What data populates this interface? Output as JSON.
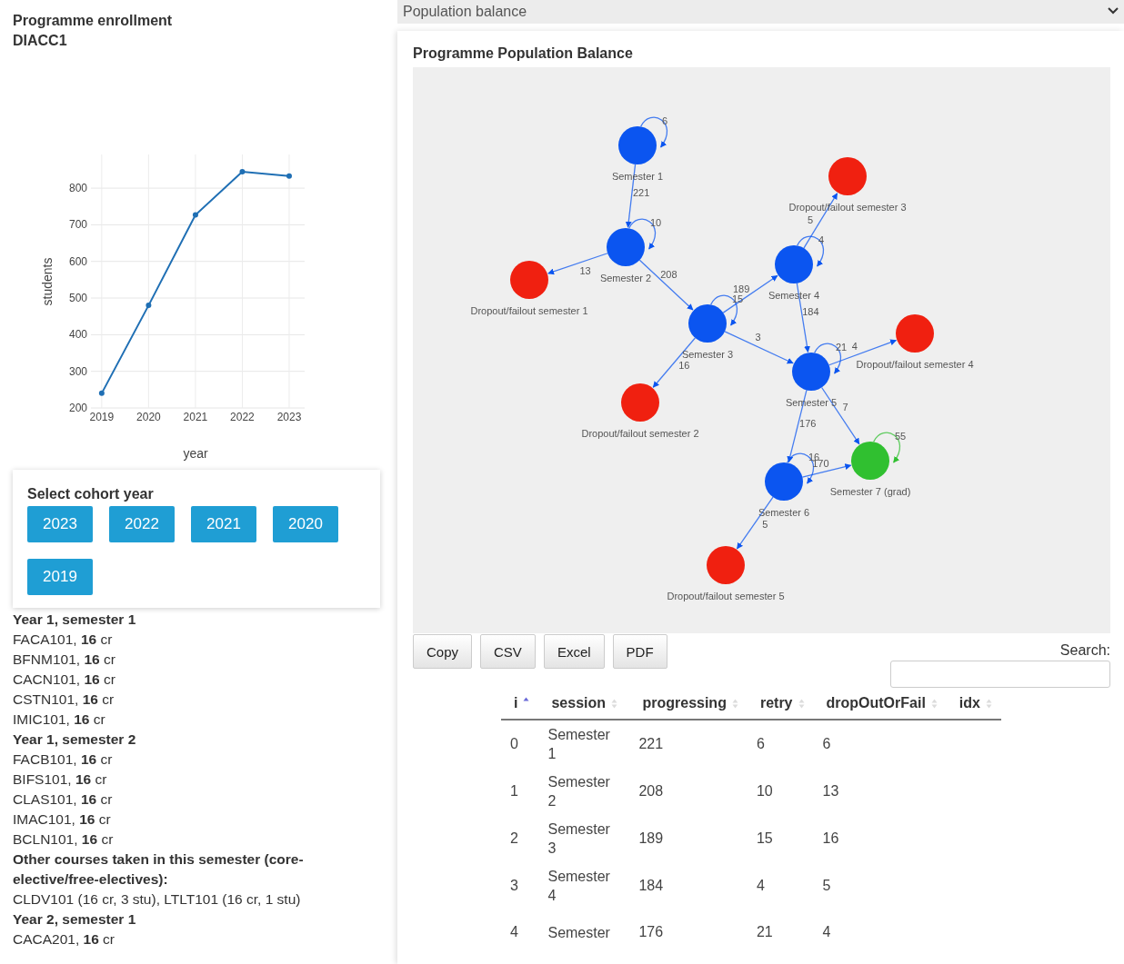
{
  "enrollment": {
    "title": "Programme enrollment",
    "subtitle": "DIACC1",
    "chart_data": {
      "type": "line",
      "xlabel": "year",
      "ylabel": "students",
      "grid": true,
      "x": [
        2019,
        2020,
        2021,
        2022,
        2023
      ],
      "xticks": [
        2019,
        2020,
        2021,
        2022,
        2023
      ],
      "yticks": [
        200,
        300,
        400,
        500,
        600,
        700,
        800
      ],
      "xlim": [
        2018.77,
        2023.33
      ],
      "ylim": [
        200,
        892
      ],
      "series": [
        {
          "color": "#1f6fb4",
          "marker": true,
          "values": [
            240,
            480,
            727,
            845,
            833
          ]
        }
      ]
    }
  },
  "cohort": {
    "title": "Select cohort year",
    "years": [
      "2023",
      "2022",
      "2021",
      "2020",
      "2019"
    ]
  },
  "courses": [
    {
      "kind": "heading",
      "text": "Year 1, semester 1"
    },
    {
      "kind": "course",
      "text": "FACA101, **16** cr"
    },
    {
      "kind": "course",
      "text": "BFNM101, **16** cr"
    },
    {
      "kind": "course",
      "text": "CACN101, **16** cr"
    },
    {
      "kind": "course",
      "text": "CSTN101, **16** cr"
    },
    {
      "kind": "course",
      "text": "IMIC101, **16** cr"
    },
    {
      "kind": "heading",
      "text": "Year 1, semester 2"
    },
    {
      "kind": "course",
      "text": "FACB101, **16** cr"
    },
    {
      "kind": "course",
      "text": "BIFS101, **16** cr"
    },
    {
      "kind": "course",
      "text": "CLAS101, **16** cr"
    },
    {
      "kind": "course",
      "text": "IMAC101, **16** cr"
    },
    {
      "kind": "course",
      "text": "BCLN101, **16** cr"
    },
    {
      "kind": "heading",
      "text": "Other courses taken in this semester (core-elective/free-electives):"
    },
    {
      "kind": "course",
      "text": "CLDV101 (16 cr, 3 stu), LTLT101 (16 cr, 1 stu)"
    },
    {
      "kind": "heading",
      "text": "Year 2, semester 1"
    },
    {
      "kind": "course",
      "text": "CACA201, **16** cr"
    }
  ],
  "view_select": {
    "value": "Population balance"
  },
  "balance": {
    "title": "Programme Population Balance",
    "nodes": [
      {
        "label": "Semester 1",
        "color": "#0b55f0"
      },
      {
        "label": "Dropout/failout semester 3",
        "color": "#f02010"
      },
      {
        "label": "Semester 2",
        "color": "#0b55f0"
      },
      {
        "label": "Semester 4",
        "color": "#0b55f0"
      },
      {
        "label": "Dropout/failout semester 1",
        "color": "#f02010"
      },
      {
        "label": "Semester 3",
        "color": "#0b55f0"
      },
      {
        "label": "Dropout/failout semester 4",
        "color": "#f02010"
      },
      {
        "label": "Semester 5",
        "color": "#0b55f0"
      },
      {
        "label": "Dropout/failout semester 2",
        "color": "#f02010"
      },
      {
        "label": "Semester 7 (grad)",
        "color": "#30c030"
      },
      {
        "label": "Semester 6",
        "color": "#0b55f0"
      },
      {
        "label": "Dropout/failout semester 5",
        "color": "#f02010"
      }
    ],
    "edges": [
      {
        "label": "6"
      },
      {
        "label": "221"
      },
      {
        "label": "5"
      },
      {
        "label": "10"
      },
      {
        "label": "4"
      },
      {
        "label": "13"
      },
      {
        "label": "208"
      },
      {
        "label": "189"
      },
      {
        "label": "15"
      },
      {
        "label": "184"
      },
      {
        "label": "16"
      },
      {
        "label": "3"
      },
      {
        "label": "21"
      },
      {
        "label": "4"
      },
      {
        "label": "176"
      },
      {
        "label": "7"
      },
      {
        "label": "55"
      },
      {
        "label": "16"
      },
      {
        "label": "170"
      },
      {
        "label": "5"
      }
    ]
  },
  "export_buttons": [
    "Copy",
    "CSV",
    "Excel",
    "PDF"
  ],
  "search": {
    "label": "Search:"
  },
  "table": {
    "columns": [
      {
        "label": "i",
        "sorted": true
      },
      {
        "label": "session",
        "sorted": false
      },
      {
        "label": "progressing",
        "sorted": false
      },
      {
        "label": "retry",
        "sorted": false
      },
      {
        "label": "dropOutOrFail",
        "sorted": false
      },
      {
        "label": "idx",
        "sorted": false
      }
    ],
    "rows": [
      [
        "0",
        "Semester 1",
        "221",
        "6",
        "6"
      ],
      [
        "1",
        "Semester 2",
        "208",
        "10",
        "13"
      ],
      [
        "2",
        "Semester 3",
        "189",
        "15",
        "16"
      ],
      [
        "3",
        "Semester 4",
        "184",
        "4",
        "5"
      ],
      [
        "4",
        "Semester",
        "176",
        "21",
        "4"
      ]
    ]
  }
}
